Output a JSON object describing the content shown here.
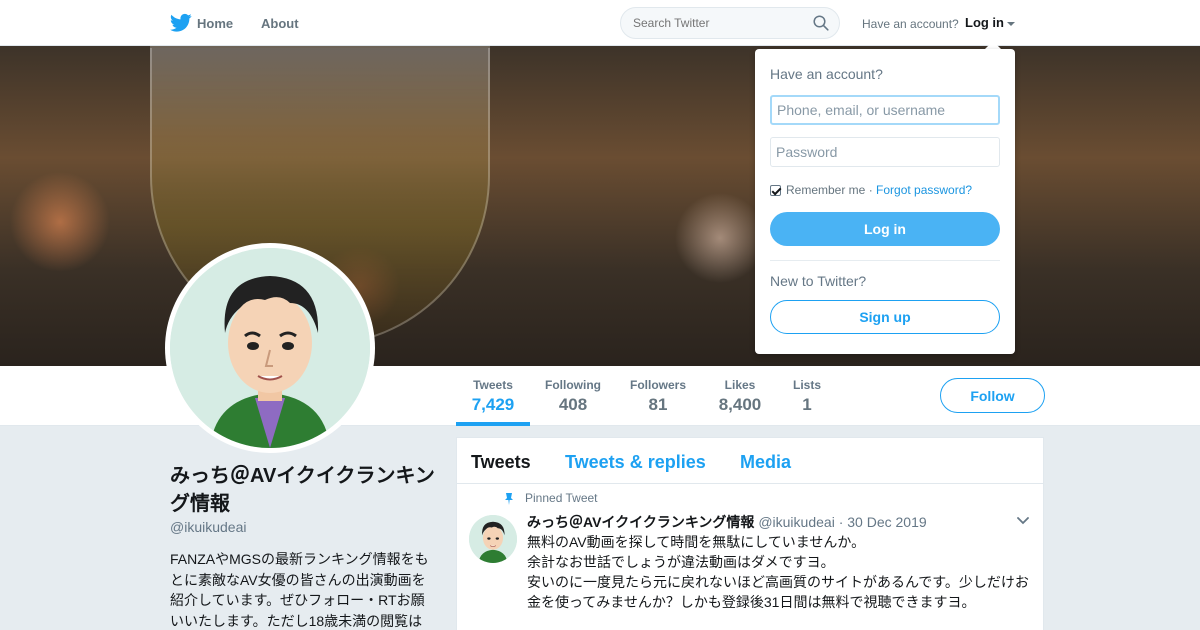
{
  "nav": {
    "logo_icon": "twitter-bird-icon",
    "home_label": "Home",
    "about_label": "About",
    "search_placeholder": "Search Twitter",
    "search_icon": "magnifier-icon",
    "have_account": "Have an account?",
    "login_label": "Log in"
  },
  "profile": {
    "name": "みっち＠AVイクイクランキング情報",
    "handle": "@ikuikudeai",
    "bio": "FANZAやMGSの最新ランキング情報をもとに素敵なAV女優の皆さんの出演動画を紹介しています。ぜひフォロー・RTお願いいたします。ただし18歳未満の閲覧は"
  },
  "stats": [
    {
      "label": "Tweets",
      "value": "7,429"
    },
    {
      "label": "Following",
      "value": "408"
    },
    {
      "label": "Followers",
      "value": "81"
    },
    {
      "label": "Likes",
      "value": "8,400"
    },
    {
      "label": "Lists",
      "value": "1"
    }
  ],
  "follow_label": "Follow",
  "timeline": {
    "tabs": [
      "Tweets",
      "Tweets & replies",
      "Media"
    ],
    "pinned_label": "Pinned Tweet",
    "tweet": {
      "author": "みっち＠AVイクイクランキング情報",
      "handle": "@ikuikudeai",
      "separator": "·",
      "date": "30 Dec 2019",
      "text": "無料のAV動画を探して時間を無駄にしていませんか。\n余計なお世話でしょうが違法動画はダメですヨ。\n安いのに一度見たら元に戻れないほど高画質のサイトがあるんです。少しだけお金を使ってみませんか？しかも登録後31日間は無料で視聴できますヨ。"
    }
  },
  "login_dropdown": {
    "title": "Have an account?",
    "username_placeholder": "Phone, email, or username",
    "password_placeholder": "Password",
    "remember_me": "Remember me",
    "separator": " · ",
    "forgot_password": "Forgot password?",
    "login_button": "Log in",
    "new_to_twitter": "New to Twitter?",
    "signup_button": "Sign up"
  },
  "colors": {
    "brand_blue": "#1da1f2",
    "login_button_bg": "#4ab3f4",
    "page_bg": "#e6ecf0"
  }
}
